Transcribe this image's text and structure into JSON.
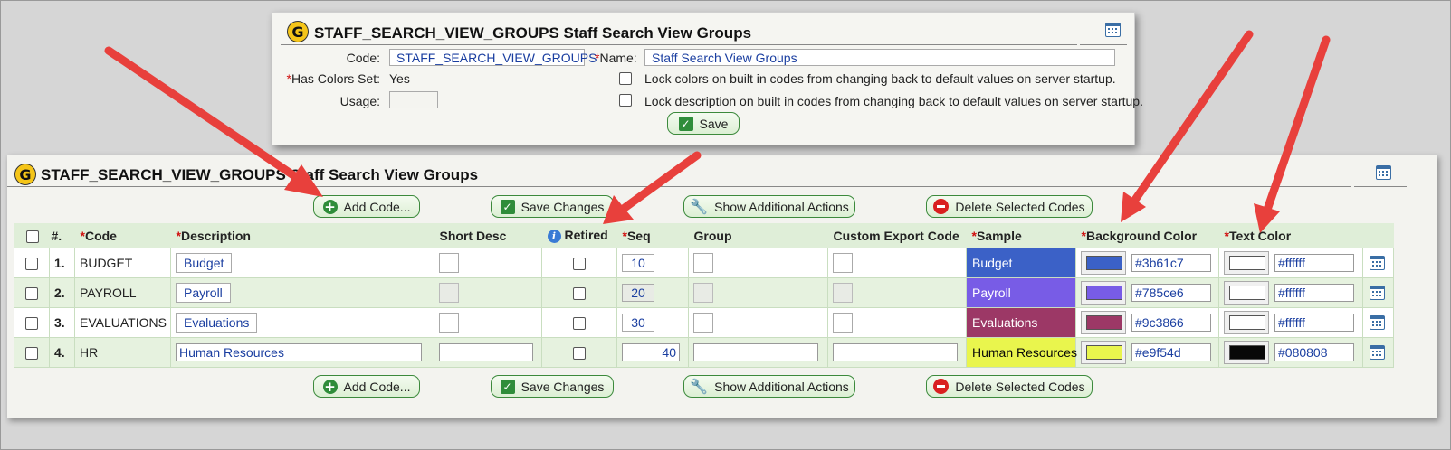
{
  "main": {
    "title": "STAFF_SEARCH_VIEW_GROUPS Staff Search View Groups",
    "toolbar": {
      "add_code": "Add Code...",
      "save_changes": "Save Changes",
      "show_actions": "Show Additional Actions",
      "delete_codes": "Delete Selected Codes"
    },
    "columns": {
      "num": "#.",
      "code": "Code",
      "description": "Description",
      "short_desc": "Short Desc",
      "retired": "Retired",
      "seq": "Seq",
      "group": "Group",
      "custom_export": "Custom Export Code",
      "sample": "Sample",
      "bg_color": "Background Color",
      "text_color": "Text Color"
    },
    "rows": [
      {
        "num": "1.",
        "code": "BUDGET",
        "description": "Budget",
        "seq": "10",
        "sample": "Budget",
        "bg": "#3b61c7",
        "fg": "#ffffff"
      },
      {
        "num": "2.",
        "code": "PAYROLL",
        "description": "Payroll",
        "seq": "20",
        "sample": "Payroll",
        "bg": "#785ce6",
        "fg": "#ffffff"
      },
      {
        "num": "3.",
        "code": "EVALUATIONS",
        "description": "Evaluations",
        "seq": "30",
        "sample": "Evaluations",
        "bg": "#9c3866",
        "fg": "#ffffff"
      },
      {
        "num": "4.",
        "code": "HR",
        "description": "Human Resources",
        "seq": "40",
        "sample": "Human Resources",
        "bg": "#e9f54d",
        "fg": "#080808"
      }
    ]
  },
  "popup": {
    "title": "STAFF_SEARCH_VIEW_GROUPS Staff Search View Groups",
    "code_label": "Code:",
    "code_value": "STAFF_SEARCH_VIEW_GROUPS",
    "name_label": "Name:",
    "name_value": "Staff Search View Groups",
    "has_colors_label": "Has Colors Set:",
    "has_colors_value": "Yes",
    "usage_label": "Usage:",
    "lock_colors": "Lock colors on built in codes from changing back to default values on server startup.",
    "lock_description": "Lock description on built in codes from changing back to default values on server startup.",
    "save": "Save"
  },
  "colors": {
    "accent_green": "#3c8a3c",
    "arrow_red": "#e8403c",
    "required": "#d01010"
  }
}
